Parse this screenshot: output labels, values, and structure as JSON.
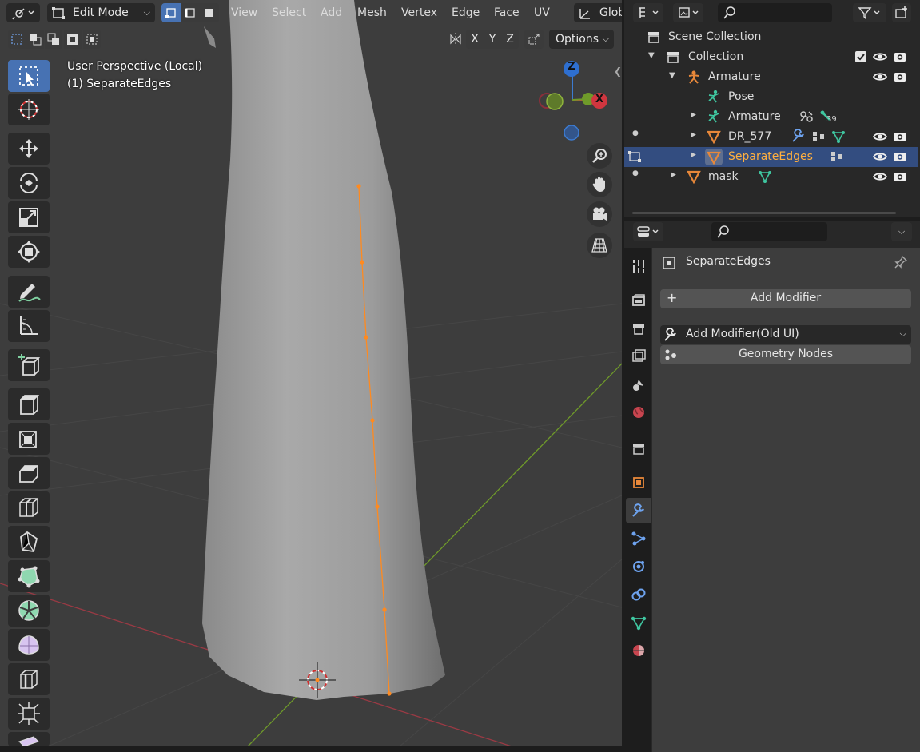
{
  "viewport": {
    "header": {
      "mode": "Edit Mode",
      "menus": [
        "View",
        "Select",
        "Add",
        "Mesh",
        "Vertex",
        "Edge",
        "Face",
        "UV"
      ],
      "orientation": "Glob",
      "axes": [
        "X",
        "Y",
        "Z"
      ],
      "options_label": "Options"
    },
    "overlay": {
      "perspective": "User Perspective (Local)",
      "object": "(1) SeparateEdges"
    },
    "gizmo": {
      "z_label": "Z",
      "x_label": "X"
    },
    "tools": [
      "select-box",
      "cursor",
      "move",
      "rotate",
      "scale",
      "transform",
      "annotate",
      "measure",
      "add-cube",
      "extrude-region",
      "inset-faces",
      "bevel",
      "loop-cut",
      "knife",
      "poly-build",
      "spin",
      "smooth",
      "edge-slide",
      "shrink-fatten",
      "shear"
    ],
    "active_tool": "select-box",
    "colors": {
      "accent": "#4772b3",
      "vertex": "#ff8a1f",
      "axis_x": "#9a3a44",
      "axis_y": "#6f9a2a"
    }
  },
  "outliner": {
    "search_placeholder": "",
    "rows": [
      {
        "label": "Scene Collection",
        "icon": "scene-collection-icon"
      },
      {
        "label": "Collection",
        "icon": "collection-icon"
      },
      {
        "label": "Armature",
        "icon": "armature-object-icon"
      },
      {
        "label": "Pose",
        "icon": "pose-icon"
      },
      {
        "label": "Armature",
        "icon": "armature-data-icon",
        "badge": "39"
      },
      {
        "label": "DR_577",
        "icon": "mesh-object-icon"
      },
      {
        "label": "SeparateEdges",
        "icon": "mesh-object-icon"
      },
      {
        "label": "mask",
        "icon": "mesh-object-icon"
      }
    ]
  },
  "properties": {
    "search_placeholder": "",
    "object_name": "SeparateEdges",
    "add_modifier_label": "Add Modifier",
    "add_modifier_old_label": "Add Modifier(Old UI)",
    "geometry_nodes_label": "Geometry Nodes",
    "tabs": [
      "tool",
      "render",
      "output",
      "view-layer",
      "scene",
      "world",
      "collection",
      "object",
      "modifiers",
      "particles",
      "physics",
      "constraints",
      "data",
      "material"
    ],
    "active_tab": "modifiers"
  }
}
